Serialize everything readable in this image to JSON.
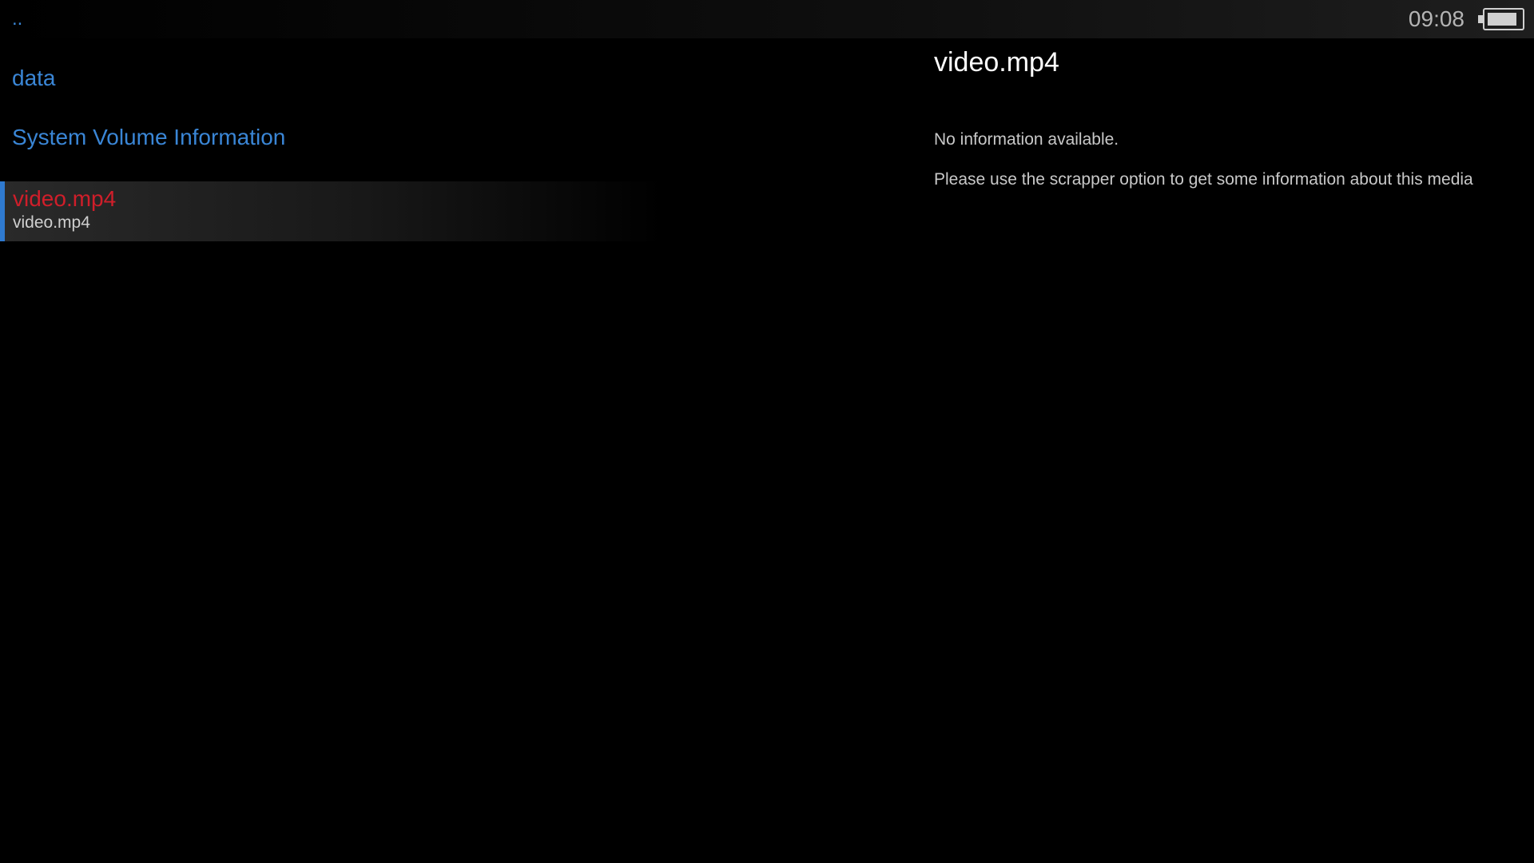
{
  "status_bar": {
    "parent_dir": "..",
    "time": "09:08",
    "battery_icon": "battery-icon",
    "battery_level": 0.9
  },
  "file_list": {
    "items": [
      {
        "label": "data",
        "type": "folder"
      },
      {
        "label": "System Volume Information",
        "type": "folder"
      }
    ],
    "selected": {
      "title": "video.mp4",
      "subtitle": "video.mp4"
    }
  },
  "info_panel": {
    "title": "video.mp4",
    "message": "No information available.",
    "hint": "Please use the scrapper option to get some information about this media"
  },
  "colors": {
    "accent": "#2f7ad0",
    "folder_text": "#3a86d6",
    "selected_title": "#d01e2a",
    "background": "#000000"
  }
}
